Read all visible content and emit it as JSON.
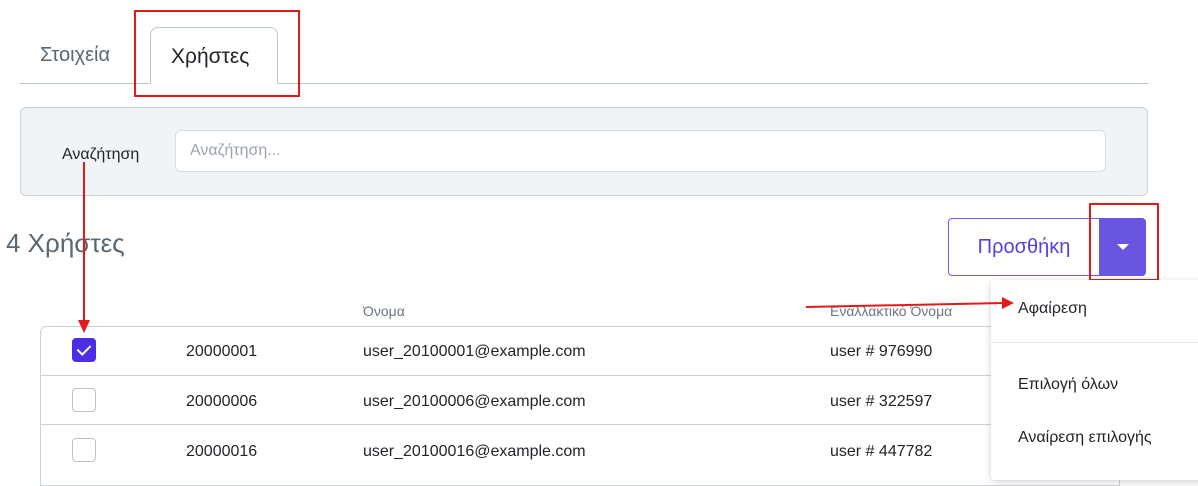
{
  "tabs": [
    {
      "label": "Στοιχεία",
      "active": false
    },
    {
      "label": "Χρήστες",
      "active": true
    }
  ],
  "search": {
    "label": "Αναζήτηση",
    "placeholder": "Αναζήτηση...",
    "value": ""
  },
  "count_heading": "4 Χρήστες",
  "actions": {
    "add_label": "Προσθήκη",
    "dropdown_icon": "caret-down-icon"
  },
  "table": {
    "headers": [
      "",
      "",
      "Όνομα",
      "Εναλλακτικό Όνομα"
    ],
    "rows": [
      {
        "checked": true,
        "id": "20000001",
        "name": "user_20100001@example.com",
        "alt_name": "user # 976990"
      },
      {
        "checked": false,
        "id": "20000006",
        "name": "user_20100006@example.com",
        "alt_name": "user # 322597"
      },
      {
        "checked": false,
        "id": "20000016",
        "name": "user_20100016@example.com",
        "alt_name": "user # 447782"
      }
    ]
  },
  "dropdown_menu": {
    "items": [
      "Αφαίρεση",
      "Επιλογή όλων",
      "Αναίρεση επιλογής"
    ]
  },
  "colors": {
    "accent": "#6a55e0",
    "checkbox_checked": "#4a2fe6",
    "highlight_annotation": "#e01b1b"
  }
}
